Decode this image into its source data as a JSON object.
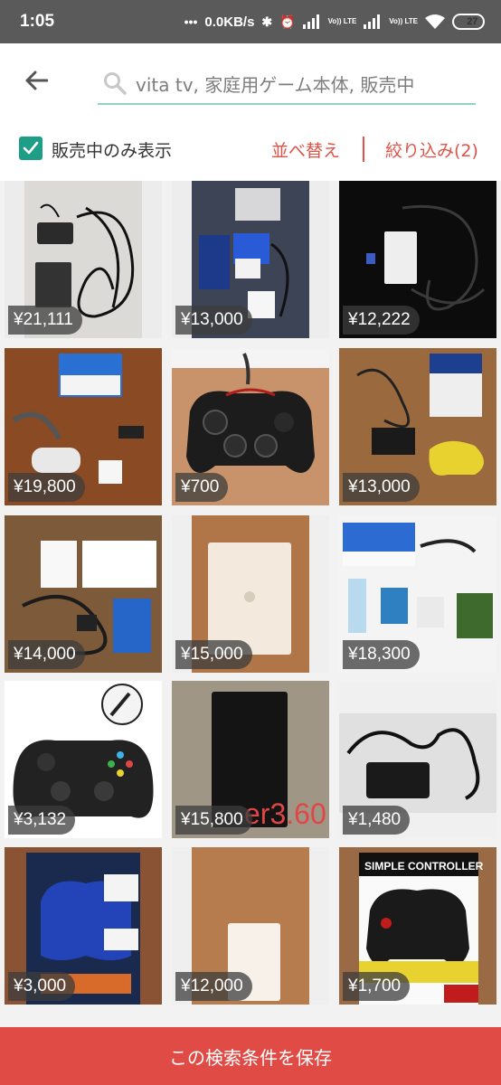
{
  "status_bar": {
    "time": "1:05",
    "network_speed": "0.0KB/s",
    "lte_label": "Vo)) LTE",
    "battery": "27",
    "battery_level": 0.27
  },
  "search": {
    "query": "vita tv, 家庭用ゲーム本体, 販売中"
  },
  "filter": {
    "checkbox_label": "販売中のみ表示",
    "checked": true,
    "sort_label": "並べ替え",
    "refine_label": "絞り込み(2)"
  },
  "items": [
    {
      "price": "¥21,111",
      "thumb": "vita-tv-unit-cables"
    },
    {
      "price": "¥13,000",
      "thumb": "boxed-set-on-fabric"
    },
    {
      "price": "¥12,222",
      "thumb": "white-unit-black-bg"
    },
    {
      "price": "¥19,800",
      "thumb": "boxed-set-wood"
    },
    {
      "price": "¥700",
      "thumb": "black-red-controller"
    },
    {
      "price": "¥13,000",
      "thumb": "yellow-controller-set"
    },
    {
      "price": "¥14,000",
      "thumb": "white-set-with-box"
    },
    {
      "price": "¥15,000",
      "thumb": "white-unit-closeup"
    },
    {
      "price": "¥18,300",
      "thumb": "set-with-games"
    },
    {
      "price": "¥3,132",
      "thumb": "black-controller-usb"
    },
    {
      "price": "¥15,800",
      "thumb": "black-unit-on-carpet"
    },
    {
      "price": "¥1,480",
      "thumb": "ac-adapter"
    },
    {
      "price": "¥3,000",
      "thumb": "blue-controller-package"
    },
    {
      "price": "¥12,000",
      "thumb": "white-unit-on-wood"
    },
    {
      "price": "¥1,700",
      "thumb": "simple-controller-package"
    }
  ],
  "overlay_text": "er3.60",
  "package_text": "SIMPLE CONTROLLER",
  "save_button": "この検索条件を保存",
  "colors": {
    "accent": "#e05246",
    "checkbox": "#1e9e86",
    "search_underline": "#8fd3c9"
  }
}
